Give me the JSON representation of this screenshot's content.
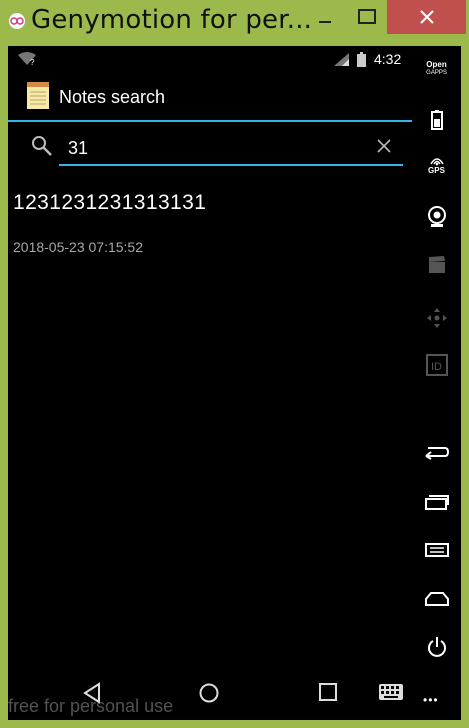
{
  "window": {
    "title": "Genymotion for per..."
  },
  "statusbar": {
    "time": "4:32"
  },
  "actionbar": {
    "title": "Notes search"
  },
  "search": {
    "value": "31"
  },
  "results": [
    {
      "title": "1231231231313131",
      "date": "2018-05-23 07:15:52"
    }
  ],
  "watermark": "free for personal use",
  "sidebar": {
    "opengapps_line1": "Open",
    "opengapps_line2": "GAPPS",
    "gps_label": "GPS",
    "more": "•••"
  },
  "icons": {
    "window": [
      "genymotion-logo-icon",
      "minimize-icon",
      "maximize-icon",
      "close-icon"
    ],
    "status": [
      "wifi-icon",
      "signal-icon",
      "battery-icon"
    ],
    "nav": [
      "back-icon",
      "home-icon",
      "recent-apps-icon",
      "keyboard-icon"
    ],
    "sidebar": [
      "open-gapps-icon",
      "battery-icon",
      "gps-icon",
      "webcam-icon",
      "clapperboard-icon",
      "dpad-icon",
      "id-icon",
      "back-icon",
      "recent-apps-icon",
      "menu-icon",
      "home-icon",
      "power-icon",
      "more-icon"
    ]
  },
  "colors": {
    "frame": "#9cba4c",
    "close": "#c0504d",
    "accent": "#33b5e5",
    "screen": "#000000"
  }
}
